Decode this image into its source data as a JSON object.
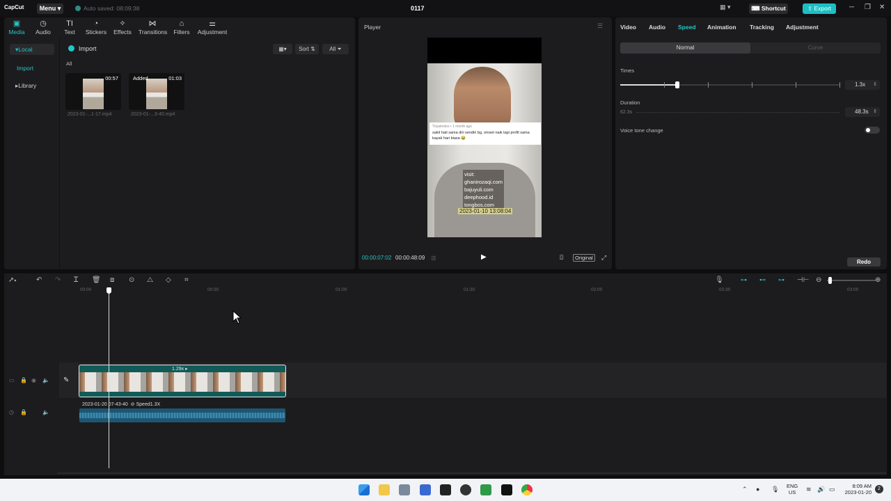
{
  "titlebar": {
    "logo": "CapCut",
    "menu_label": "Menu ▾",
    "autosave_label": "Auto saved: 08:09:38",
    "project_title": "0117",
    "shortcut_label": "Shortcut",
    "export_label": "Export"
  },
  "tool_tabs": [
    {
      "label": "Media",
      "icon": "media-icon"
    },
    {
      "label": "Audio",
      "icon": "audio-icon"
    },
    {
      "label": "Text",
      "icon": "text-icon"
    },
    {
      "label": "Stickers",
      "icon": "stickers-icon"
    },
    {
      "label": "Effects",
      "icon": "effects-icon"
    },
    {
      "label": "Transitions",
      "icon": "transitions-icon"
    },
    {
      "label": "Filters",
      "icon": "filters-icon"
    },
    {
      "label": "Adjustment",
      "icon": "adjustment-icon"
    }
  ],
  "media": {
    "side_items": [
      "Local",
      "Import",
      "Library"
    ],
    "import_label": "Import",
    "sort_label": "Sort",
    "all_filter_label": "All",
    "all_label": "All",
    "thumbs": [
      {
        "duration": "00:57",
        "added": "",
        "name": "2023-01-...1-17.mp4"
      },
      {
        "duration": "01:03",
        "added": "Added",
        "name": "2023-01-...3-40.mp4"
      }
    ]
  },
  "player": {
    "title": "Player",
    "comment_meta": "Triyatmoko  •  1 month ago",
    "comment_text": "sakit hati sama diri sendiri bg, omset naik tapi profit sama kayak hari biasa 😂",
    "overlay_lines": [
      "visit:",
      "ghanirozaqi.com",
      "bajuyuli.com",
      "deephood.id",
      "tongbos.com"
    ],
    "timestamp": "2023-01-10 13:08:04",
    "time_current": "00:00:07:02",
    "time_total": "00:00:48:09",
    "original_label": "Original"
  },
  "props": {
    "tabs": [
      "Video",
      "Audio",
      "Speed",
      "Animation",
      "Tracking",
      "Adjustment"
    ],
    "active_tab": "Speed",
    "seg_normal": "Normal",
    "seg_curve": "Curve",
    "times_label": "Times",
    "times_value": "1.3x",
    "speed_fraction": 0.26,
    "duration_label": "Duration",
    "duration_original": "62.3s",
    "duration_value": "48.3s",
    "voice_label": "Voice tone change",
    "redo_label": "Redo"
  },
  "timeline": {
    "ruler": [
      "00:00",
      "00:30",
      "01:00",
      "01:30",
      "02:00",
      "02:30",
      "03:00"
    ],
    "clip_speed": "1.29x ▸",
    "audio_label": "2023-01-20 07-43-40",
    "audio_speed": "Speed1.3X"
  },
  "taskbar": {
    "lang_line1": "ENG",
    "lang_line2": "US",
    "time": "8:09 AM",
    "date": "2023-01-20"
  },
  "colors": {
    "accent": "#23c6c8",
    "panel": "#1c1c1e",
    "background": "#0e0e0f"
  }
}
